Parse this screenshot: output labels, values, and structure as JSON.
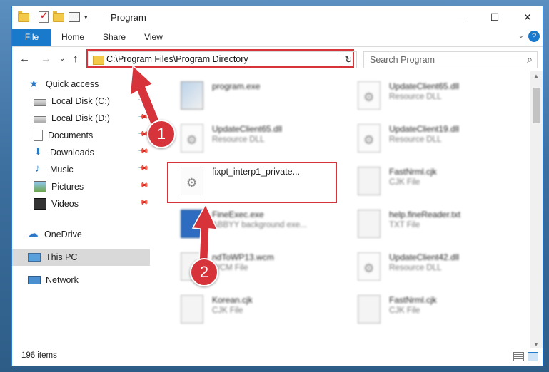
{
  "window": {
    "title": "Program",
    "minimize_glyph": "—",
    "maximize_glyph": "☐",
    "close_glyph": "✕"
  },
  "ribbon": {
    "tabs": [
      "File",
      "Home",
      "Share",
      "View"
    ],
    "expand_glyph": "⌄",
    "help_glyph": "?"
  },
  "navbar": {
    "back_glyph": "←",
    "forward_glyph": "→",
    "recent_glyph": "⌄",
    "up_glyph": "↑",
    "address": "C:\\Program Files\\Program Directory",
    "address_drop_glyph": "⌄",
    "refresh_glyph": "↻",
    "search_placeholder": "Search Program",
    "search_glyph": "⌕"
  },
  "navpane": {
    "items": [
      {
        "label": "Quick access",
        "icon": "star-icon"
      },
      {
        "label": "Local Disk (C:)",
        "icon": "disk-icon",
        "pinned": true
      },
      {
        "label": "Local Disk (D:)",
        "icon": "disk-icon",
        "pinned": true
      },
      {
        "label": "Documents",
        "icon": "document-icon",
        "pinned": true
      },
      {
        "label": "Downloads",
        "icon": "download-icon",
        "pinned": true
      },
      {
        "label": "Music",
        "icon": "music-icon",
        "pinned": true
      },
      {
        "label": "Pictures",
        "icon": "pictures-icon",
        "pinned": true
      },
      {
        "label": "Videos",
        "icon": "video-icon",
        "pinned": true
      },
      {
        "label": "OneDrive",
        "icon": "cloud-icon"
      },
      {
        "label": "This PC",
        "icon": "computer-icon",
        "selected": true
      },
      {
        "label": "Network",
        "icon": "network-icon"
      }
    ],
    "pin_glyph": "📌"
  },
  "files": [
    {
      "name": "program.exe",
      "type": ""
    },
    {
      "name": "UpdateClient65.dll",
      "type": "Resource DLL"
    },
    {
      "name": "UpdateClient65.dll",
      "type": "Resource DLL"
    },
    {
      "name": "UpdateClient19.dll",
      "type": "Resource DLL"
    },
    {
      "name": "fixpt_interp1_private...",
      "type": ""
    },
    {
      "name": "FastNrml.cjk",
      "type": "CJK File"
    },
    {
      "name": "FineExec.exe",
      "type": "ABBYY background exe..."
    },
    {
      "name": "help.fineReader.txt",
      "type": "TXT File"
    },
    {
      "name": "ndToWP13.wcm",
      "type": "WCM File"
    },
    {
      "name": "UpdateClient42.dll",
      "type": "Resource DLL"
    },
    {
      "name": "Korean.cjk",
      "type": "CJK File"
    },
    {
      "name": "FastNrml.cjk",
      "type": "CJK File"
    }
  ],
  "status": {
    "item_count": "196 items"
  },
  "callouts": [
    "1",
    "2"
  ],
  "colors": {
    "accent": "#1979ca",
    "highlight": "#d6333a"
  }
}
